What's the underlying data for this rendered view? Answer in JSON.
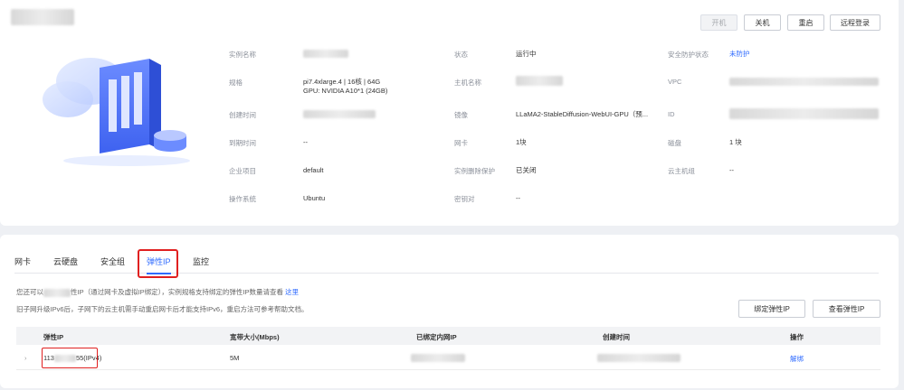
{
  "toolbar": {
    "power_on": "开机",
    "power_off": "关机",
    "restart": "重启",
    "remote_login": "远程登录"
  },
  "details": {
    "col1": [
      {
        "label": "实例名称",
        "value": ""
      },
      {
        "label": "规格",
        "value": "pi7.4xlarge.4 | 16核 | 64G",
        "value2": "GPU: NVIDIA A10*1 (24GB)"
      },
      {
        "label": "创建时间",
        "value": ""
      },
      {
        "label": "到期时间",
        "value": "--"
      },
      {
        "label": "企业项目",
        "value": "default"
      },
      {
        "label": "操作系统",
        "value": "Ubuntu"
      }
    ],
    "col2": [
      {
        "label": "状态",
        "value": "运行中"
      },
      {
        "label": "主机名称",
        "value": ""
      },
      {
        "label": "镜像",
        "value": "LLaMA2-StableDiffusion-WebUI-GPU（预..."
      },
      {
        "label": "网卡",
        "value": "1块"
      },
      {
        "label": "实例删除保护",
        "value": "已关闭"
      },
      {
        "label": "密钥对",
        "value": "--"
      }
    ],
    "col3": [
      {
        "label": "安全防护状态",
        "value": "未防护"
      },
      {
        "label": "VPC",
        "value": ""
      },
      {
        "label": "ID",
        "value": ""
      },
      {
        "label": "磁盘",
        "value": "1 块"
      },
      {
        "label": "云主机组",
        "value": "--"
      }
    ]
  },
  "tabs": [
    "网卡",
    "云硬盘",
    "安全组",
    "弹性IP",
    "监控"
  ],
  "active_tab": "弹性IP",
  "info": {
    "line1_a": "您还可以",
    "line1_b": "性IP（通过网卡及虚拟IP绑定），实例规格支持绑定的弹性IP数量请查看",
    "line1_link": "这里",
    "line2": "旧子网升级IPv6后，子网下的云主机需手动重启网卡后才能支持IPv6，重启方法可参考帮助文档。"
  },
  "actions": {
    "bind_eip": "绑定弹性IP",
    "view_eip": "查看弹性IP"
  },
  "table": {
    "headers": [
      "弹性IP",
      "宽带大小(Mbps)",
      "已绑定内网IP",
      "创建时间",
      "操作"
    ],
    "rows": [
      {
        "eip_prefix": "113",
        "eip_suffix": "55(IPv4)",
        "bandwidth": "5M",
        "action": "解绑"
      }
    ]
  },
  "colors": {
    "accent": "#2f6bff",
    "highlight": "#e02020"
  }
}
